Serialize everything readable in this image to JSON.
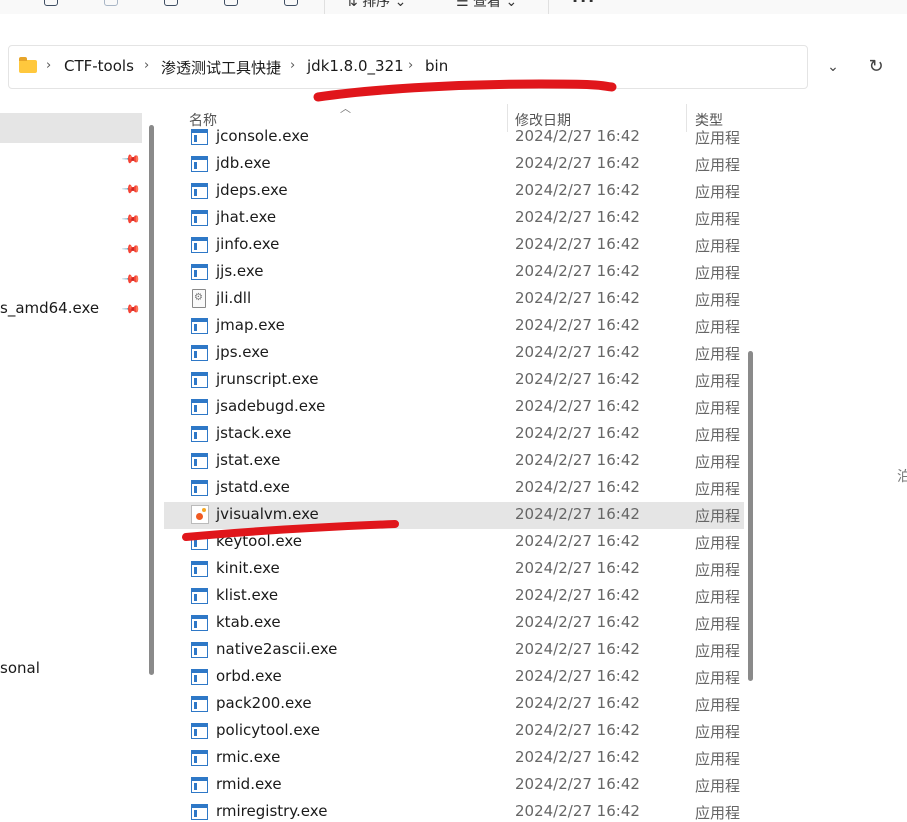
{
  "toolbar": {
    "sort_label": "排序",
    "view_label": "查看",
    "more_label": "···"
  },
  "breadcrumb": [
    "CTF-tools",
    "渗透测试工具快捷",
    "jdk1.8.0_321",
    "bin"
  ],
  "nav": {
    "items": [
      "s_amd64.exe",
      "sonal"
    ]
  },
  "columns": {
    "name": "名称",
    "date": "修改日期",
    "type": "类型"
  },
  "files": [
    {
      "name": "jconsole.exe",
      "date": "2024/2/27 16:42",
      "type": "应用程",
      "icon": "exe-icon"
    },
    {
      "name": "jdb.exe",
      "date": "2024/2/27 16:42",
      "type": "应用程",
      "icon": "exe-icon"
    },
    {
      "name": "jdeps.exe",
      "date": "2024/2/27 16:42",
      "type": "应用程",
      "icon": "exe-icon"
    },
    {
      "name": "jhat.exe",
      "date": "2024/2/27 16:42",
      "type": "应用程",
      "icon": "exe-icon"
    },
    {
      "name": "jinfo.exe",
      "date": "2024/2/27 16:42",
      "type": "应用程",
      "icon": "exe-icon"
    },
    {
      "name": "jjs.exe",
      "date": "2024/2/27 16:42",
      "type": "应用程",
      "icon": "exe-icon"
    },
    {
      "name": "jli.dll",
      "date": "2024/2/27 16:42",
      "type": "应用程",
      "icon": "dll-icon"
    },
    {
      "name": "jmap.exe",
      "date": "2024/2/27 16:42",
      "type": "应用程",
      "icon": "exe-icon"
    },
    {
      "name": "jps.exe",
      "date": "2024/2/27 16:42",
      "type": "应用程",
      "icon": "exe-icon"
    },
    {
      "name": "jrunscript.exe",
      "date": "2024/2/27 16:42",
      "type": "应用程",
      "icon": "exe-icon"
    },
    {
      "name": "jsadebugd.exe",
      "date": "2024/2/27 16:42",
      "type": "应用程",
      "icon": "exe-icon"
    },
    {
      "name": "jstack.exe",
      "date": "2024/2/27 16:42",
      "type": "应用程",
      "icon": "exe-icon"
    },
    {
      "name": "jstat.exe",
      "date": "2024/2/27 16:42",
      "type": "应用程",
      "icon": "exe-icon"
    },
    {
      "name": "jstatd.exe",
      "date": "2024/2/27 16:42",
      "type": "应用程",
      "icon": "exe-icon"
    },
    {
      "name": "jvisualvm.exe",
      "date": "2024/2/27 16:42",
      "type": "应用程",
      "icon": "jvisualvm-icon",
      "selected": true
    },
    {
      "name": "keytool.exe",
      "date": "2024/2/27 16:42",
      "type": "应用程",
      "icon": "exe-icon"
    },
    {
      "name": "kinit.exe",
      "date": "2024/2/27 16:42",
      "type": "应用程",
      "icon": "exe-icon"
    },
    {
      "name": "klist.exe",
      "date": "2024/2/27 16:42",
      "type": "应用程",
      "icon": "exe-icon"
    },
    {
      "name": "ktab.exe",
      "date": "2024/2/27 16:42",
      "type": "应用程",
      "icon": "exe-icon"
    },
    {
      "name": "native2ascii.exe",
      "date": "2024/2/27 16:42",
      "type": "应用程",
      "icon": "exe-icon"
    },
    {
      "name": "orbd.exe",
      "date": "2024/2/27 16:42",
      "type": "应用程",
      "icon": "exe-icon"
    },
    {
      "name": "pack200.exe",
      "date": "2024/2/27 16:42",
      "type": "应用程",
      "icon": "exe-icon"
    },
    {
      "name": "policytool.exe",
      "date": "2024/2/27 16:42",
      "type": "应用程",
      "icon": "exe-icon"
    },
    {
      "name": "rmic.exe",
      "date": "2024/2/27 16:42",
      "type": "应用程",
      "icon": "exe-icon"
    },
    {
      "name": "rmid.exe",
      "date": "2024/2/27 16:42",
      "type": "应用程",
      "icon": "exe-icon"
    },
    {
      "name": "rmiregistry.exe",
      "date": "2024/2/27 16:42",
      "type": "应用程",
      "icon": "exe-icon"
    }
  ],
  "edge_text": "泊",
  "colors": {
    "selection": "#e5e5e5",
    "annotation_red": "#e0161b",
    "exe_icon_blue": "#2e78c7",
    "folder_yellow": "#ffc83d"
  }
}
